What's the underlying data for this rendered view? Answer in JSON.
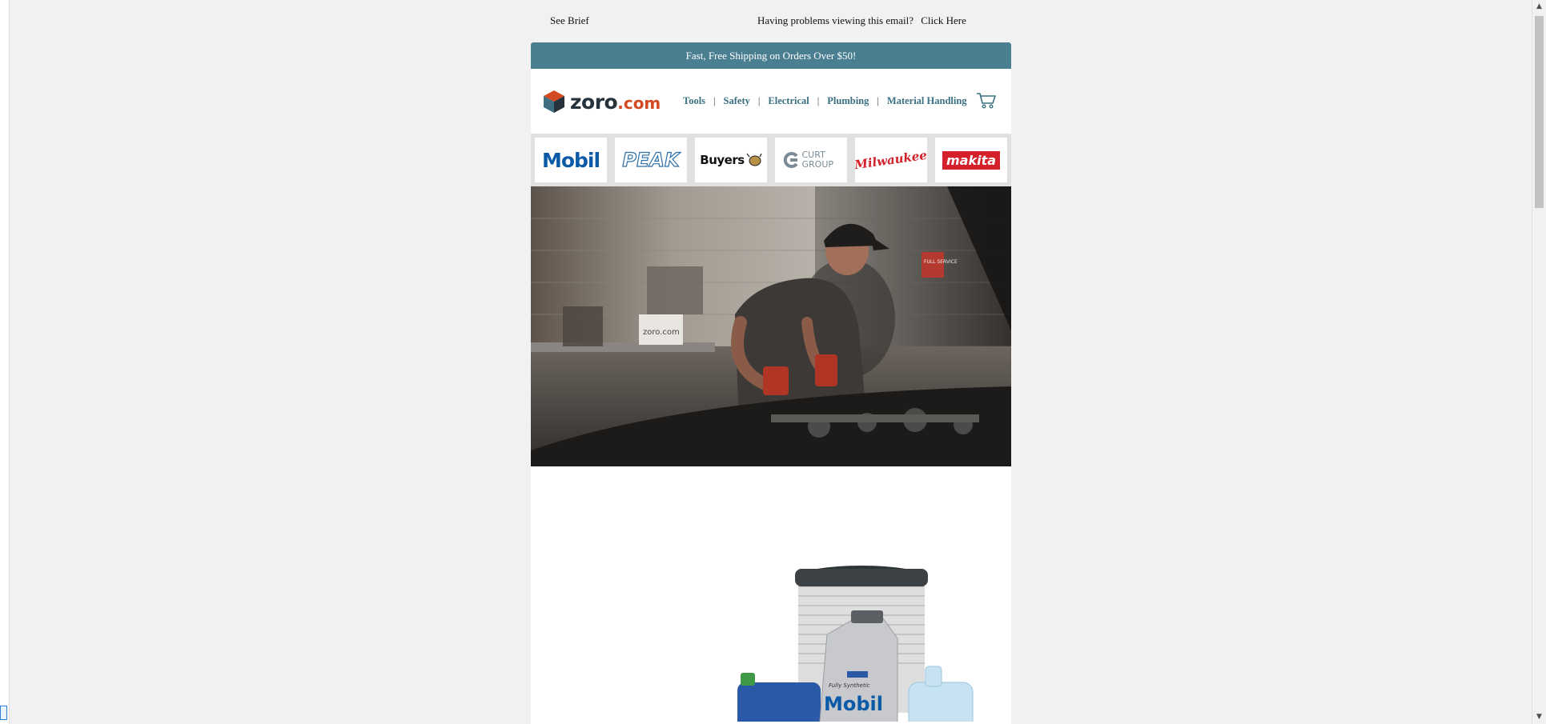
{
  "top_links": {
    "see_brief": "See Brief",
    "problems_text": "Having problems viewing this email?",
    "click_here": "Click Here"
  },
  "promo": {
    "text": "Fast, Free Shipping on Orders Over $50!"
  },
  "logo": {
    "name": "zoro",
    "suffix": ".com"
  },
  "nav": {
    "items": [
      "Tools",
      "Safety",
      "Electrical",
      "Plumbing",
      "Material Handling"
    ],
    "separator": "|"
  },
  "brands": [
    {
      "name": "Mobil",
      "color": "#0a5aa8"
    },
    {
      "name": "PEAK",
      "color": "#2e6fa8"
    },
    {
      "name": "Buyers",
      "color": "#111111"
    },
    {
      "name": "CURT GROUP",
      "color": "#7a8b96"
    },
    {
      "name": "Milwaukee",
      "color": "#d3202a"
    },
    {
      "name": "makita",
      "color": "#d3202a"
    }
  ],
  "hero": {
    "box_label": "zoro.com",
    "sign_label": "FULL SERVICE"
  },
  "products": {
    "bottle_brand": "Mobil",
    "bottle_caption": "Fully Synthetic"
  },
  "colors": {
    "promo_bg": "#4a7f92",
    "nav_text": "#3a7082",
    "logo_accent": "#d24a22",
    "page_bg": "#f1f1f1"
  }
}
